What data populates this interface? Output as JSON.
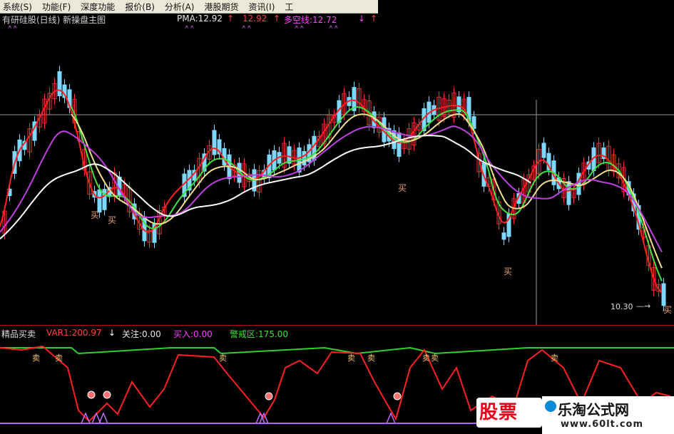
{
  "menu": {
    "items": [
      "系统(S)",
      "功能(F)",
      "深度功能",
      "报价(B)",
      "分析(A)",
      "港股期货",
      "资讯(I)",
      "工"
    ]
  },
  "header": {
    "title": "有研硅股(日线) 新操盘主图",
    "pma_label": "PMA:12.92",
    "pma_up_icon": "↑",
    "pma2_label": "12.92",
    "pma2_up_icon": "↑",
    "duokong_label": "多空线:12.72",
    "duokong_down_icon": "↓",
    "duokong_up_icon": "↑"
  },
  "main_chart": {
    "buy_labels": [
      "买",
      "买",
      "买",
      "买",
      "买"
    ],
    "low_price_label": "10.30"
  },
  "sub_chart": {
    "title": "精品买卖",
    "var1_label": "VAR1:200.97",
    "var1_down_icon": "↓",
    "guanzhu_label": "关注:0.00",
    "mairu_label": "买入:0.00",
    "jingjie_label": "警戒区:175.00",
    "sell_marker": "卖",
    "buy_marker": "买"
  },
  "watermarks": {
    "stock_logo_text": "股票",
    "site_name": "乐淘公式网",
    "site_url": "www.60lt.com"
  },
  "colors": {
    "background": "#000000",
    "up_candle": "#ff3030",
    "down_candle": "#7fd8ff",
    "ma_red": "#ff2020",
    "ma_green": "#40e040",
    "ma_yellow": "#f0e090",
    "ma_magenta": "#c040e0",
    "ma_white": "#ffffff",
    "osc_line": "#ff2020",
    "warning_line": "#30d030"
  }
}
